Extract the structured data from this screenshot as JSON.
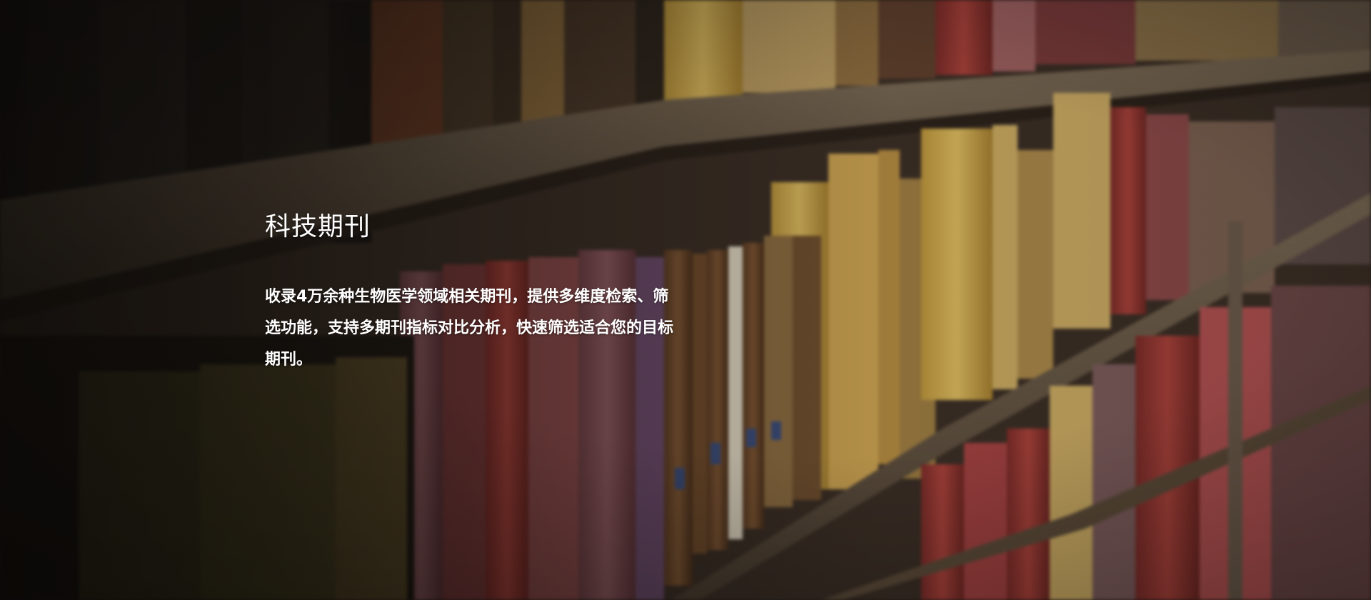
{
  "hero": {
    "title": "科技期刊",
    "description": "收录4万余种生物医学领域相关期刊，提供多维度检索、筛选功能，支持多期刊指标对比分析，快速筛选适合您的目标期刊。",
    "background": "bookshelf-photo"
  },
  "colors": {
    "text": "#ffffff",
    "overlay": "#0a0806"
  }
}
